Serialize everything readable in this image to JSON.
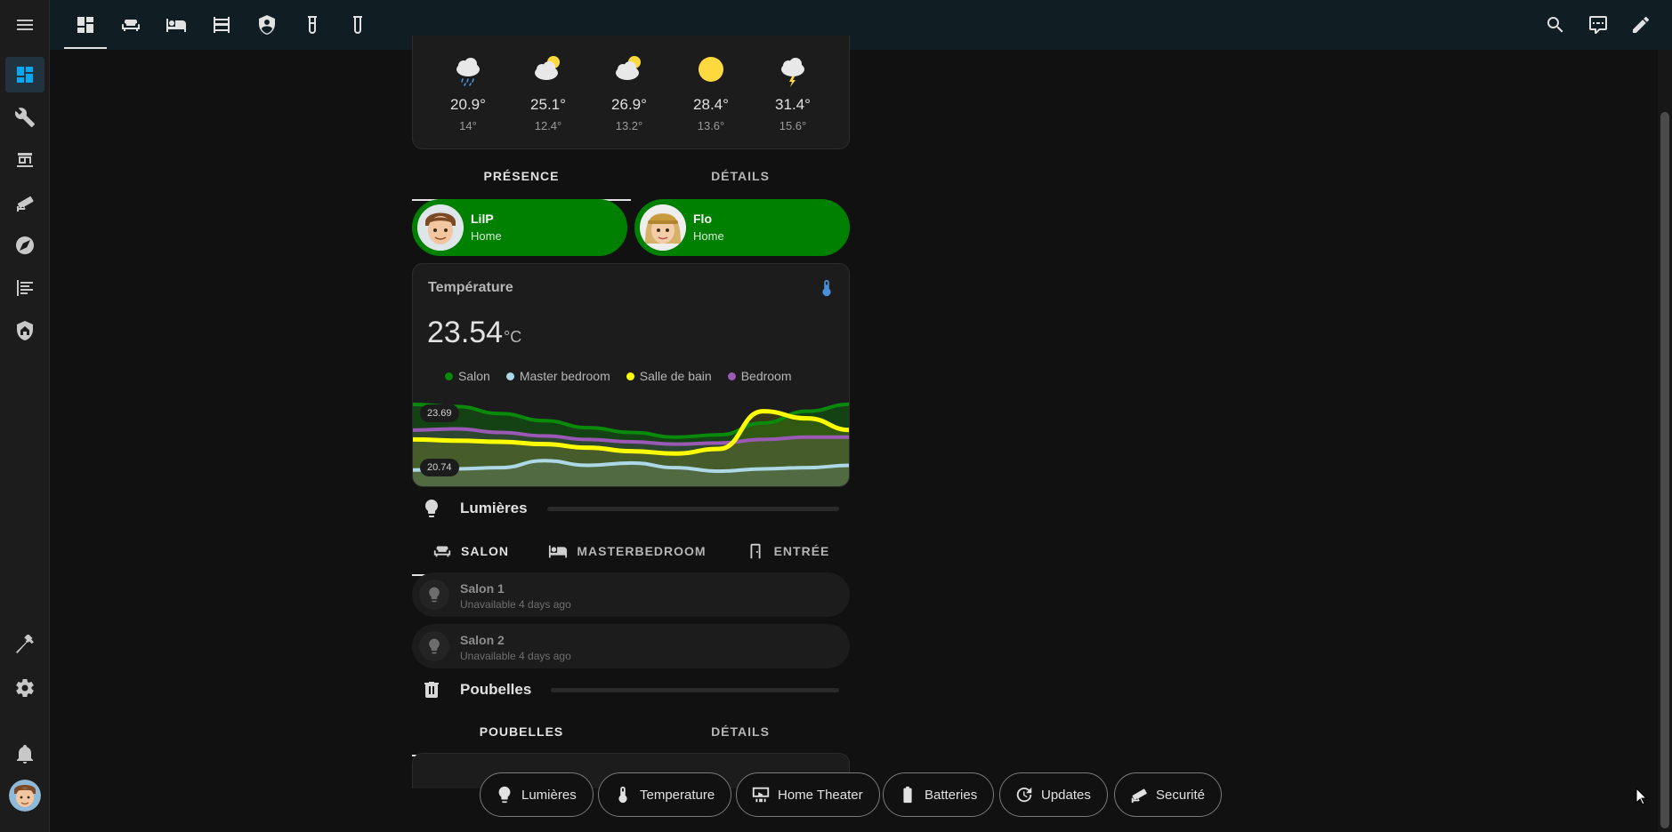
{
  "sidebar": {
    "items": [
      {
        "icon": "menu-icon"
      },
      {
        "icon": "dashboard-icon",
        "active": true
      },
      {
        "icon": "wrench-icon"
      },
      {
        "icon": "hacs-store-icon"
      },
      {
        "icon": "cctv-icon"
      },
      {
        "icon": "compass-icon"
      },
      {
        "icon": "logbook-icon"
      },
      {
        "icon": "home-shield-icon"
      },
      {
        "icon": "hammer-icon"
      },
      {
        "icon": "gear-icon"
      },
      {
        "icon": "bell-icon"
      }
    ]
  },
  "toolbar": {
    "view_icons": [
      "dashboard-icon",
      "sofa-icon",
      "bed-icon",
      "bunk-bed-icon",
      "shield-icon",
      "test-tube-icon",
      "flask-icon"
    ],
    "action_icons": [
      "search-icon",
      "assist-chat-icon",
      "pencil-icon"
    ]
  },
  "weather": {
    "forecast": [
      {
        "icon": "rainy-cloud-icon",
        "high": "20.9°",
        "low": "14°"
      },
      {
        "icon": "partly-cloudy-icon",
        "high": "25.1°",
        "low": "12.4°"
      },
      {
        "icon": "partly-cloudy-icon",
        "high": "26.9°",
        "low": "13.2°"
      },
      {
        "icon": "sunny-icon",
        "high": "28.4°",
        "low": "13.6°"
      },
      {
        "icon": "thunderstorm-icon",
        "high": "31.4°",
        "low": "15.6°"
      }
    ]
  },
  "presence_tabs": [
    {
      "label": "PRÉSENCE",
      "active": true
    },
    {
      "label": "DÉTAILS",
      "active": false
    }
  ],
  "persons": [
    {
      "name": "LilP",
      "state": "Home"
    },
    {
      "name": "Flo",
      "state": "Home"
    }
  ],
  "temperature": {
    "title": "Température",
    "value": "23.54",
    "unit": "°C",
    "max_label": "23.69",
    "min_label": "20.74",
    "colors": {
      "salon": "#0a8a0a",
      "master": "#add8e6",
      "bain": "#ffff00",
      "bedroom": "#9b59b6"
    }
  },
  "chart_data": {
    "type": "line",
    "title": "",
    "series": [
      {
        "name": "Salon",
        "values": [
          23.69,
          23.6,
          23.3,
          23.0,
          22.7,
          22.5,
          22.3,
          22.4,
          22.9,
          23.4,
          23.7
        ]
      },
      {
        "name": "Master bedroom",
        "values": [
          20.9,
          20.95,
          21.0,
          21.3,
          21.1,
          21.2,
          21.0,
          20.85,
          20.95,
          21.0,
          21.1
        ]
      },
      {
        "name": "Salle de bain",
        "values": [
          22.2,
          22.15,
          22.1,
          22.0,
          21.85,
          21.7,
          21.6,
          21.8,
          23.4,
          23.1,
          22.6
        ]
      },
      {
        "name": "Bedroom",
        "values": [
          22.6,
          22.65,
          22.5,
          22.35,
          22.2,
          22.1,
          22.0,
          22.05,
          22.2,
          22.3,
          22.3
        ]
      }
    ],
    "ylim": [
      20.74,
      23.69
    ],
    "legend": "top",
    "grid": false
  },
  "lumieres": {
    "title": "Lumières",
    "tabs": [
      {
        "label": "SALON",
        "icon": "sofa-icon",
        "active": true
      },
      {
        "label": "MASTERBEDROOM",
        "icon": "bed-icon",
        "active": false
      },
      {
        "label": "ENTRÉE",
        "icon": "door-icon",
        "active": false
      }
    ],
    "lights": [
      {
        "name": "Salon 1",
        "state": "Unavailable 4 days ago"
      },
      {
        "name": "Salon 2",
        "state": "Unavailable 4 days ago"
      }
    ]
  },
  "poubelles": {
    "title": "Poubelles",
    "tabs": [
      {
        "label": "POUBELLES",
        "active": true
      },
      {
        "label": "DÉTAILS",
        "active": false
      }
    ]
  },
  "chips": [
    {
      "label": "Lumières",
      "icon": "lightbulb-icon"
    },
    {
      "label": "Temperature",
      "icon": "thermometer-icon"
    },
    {
      "label": "Home Theater",
      "icon": "home-theater-icon"
    },
    {
      "label": "Batteries",
      "icon": "battery-icon"
    },
    {
      "label": "Updates",
      "icon": "update-icon"
    },
    {
      "label": "Securité",
      "icon": "cctv-icon"
    }
  ]
}
